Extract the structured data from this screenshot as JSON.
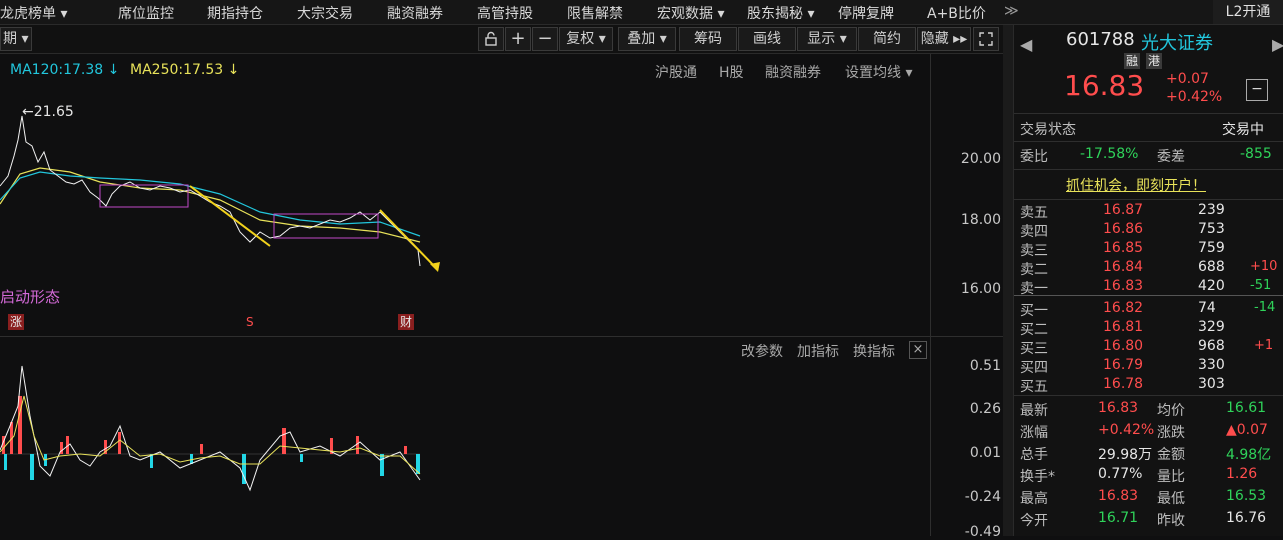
{
  "topnav": {
    "items": [
      "龙虎榜单 ▾",
      "席位监控",
      "期指持仓",
      "大宗交易",
      "融资融券",
      "高管持股",
      "限售解禁",
      "宏观数据 ▾",
      "股东揭秘 ▾",
      "停牌复牌",
      "A+B比价"
    ],
    "more": "≫",
    "l2": "L2开通"
  },
  "toolbar": {
    "period": "期 ▾",
    "buttons": [
      "复权 ▾",
      "叠加 ▾",
      "筹码",
      "画线",
      "显示 ▾",
      "简约",
      "隐藏 ▸▸"
    ],
    "plus": "+",
    "minus": "−"
  },
  "kchart": {
    "ma120": "MA120:17.38 ↓",
    "ma250": "MA250:17.53 ↓",
    "links": [
      "沪股通",
      "H股",
      "融资融券",
      "设置均线 ▾"
    ],
    "peak_label": "←21.65",
    "pattern_label": "启动形态",
    "markers": [
      "涨",
      "S",
      "财"
    ],
    "y_ticks": [
      "20.00",
      "18.00",
      "16.00"
    ]
  },
  "indicator": {
    "links": [
      "改参数",
      "加指标",
      "换指标"
    ],
    "close": "×",
    "y_ticks": [
      "0.51",
      "0.26",
      "0.01",
      "-0.24",
      "-0.49"
    ]
  },
  "stock": {
    "code": "601788",
    "name": "光大证券",
    "tags": [
      "融",
      "港"
    ],
    "price": "16.83",
    "change": "+0.07",
    "change_pct": "+0.42%",
    "status_label": "交易状态",
    "status_value": "交易中",
    "weibi_label": "委比",
    "weibi_value": "-17.58%",
    "weicha_label": "委差",
    "weicha_value": "-855",
    "promo": "抓住机会，即刻开户！"
  },
  "orderbook": {
    "sell": [
      {
        "label": "卖五",
        "price": "16.87",
        "vol": "239",
        "delta": ""
      },
      {
        "label": "卖四",
        "price": "16.86",
        "vol": "753",
        "delta": ""
      },
      {
        "label": "卖三",
        "price": "16.85",
        "vol": "759",
        "delta": ""
      },
      {
        "label": "卖二",
        "price": "16.84",
        "vol": "688",
        "delta": "+10"
      },
      {
        "label": "卖一",
        "price": "16.83",
        "vol": "420",
        "delta": "-51"
      }
    ],
    "buy": [
      {
        "label": "买一",
        "price": "16.82",
        "vol": "74",
        "delta": "-14"
      },
      {
        "label": "买二",
        "price": "16.81",
        "vol": "329",
        "delta": ""
      },
      {
        "label": "买三",
        "price": "16.80",
        "vol": "968",
        "delta": "+1"
      },
      {
        "label": "买四",
        "price": "16.79",
        "vol": "330",
        "delta": ""
      },
      {
        "label": "买五",
        "price": "16.78",
        "vol": "303",
        "delta": ""
      }
    ]
  },
  "stats": [
    {
      "l1": "最新",
      "v1": "16.83",
      "l2": "均价",
      "v2": "16.61"
    },
    {
      "l1": "涨幅",
      "v1": "+0.42%",
      "l2": "涨跌",
      "v2": "▲0.07"
    },
    {
      "l1": "总手",
      "v1": "29.98万",
      "l2": "金额",
      "v2": "4.98亿"
    },
    {
      "l1": "换手*",
      "v1": "0.77%",
      "l2": "量比",
      "v2": "1.26"
    },
    {
      "l1": "最高",
      "v1": "16.83",
      "l2": "最低",
      "v2": "16.53"
    },
    {
      "l1": "今开",
      "v1": "16.71",
      "l2": "昨收",
      "v2": "16.76"
    }
  ],
  "colors": {
    "up": "#ff4d4d",
    "down": "#2fd35a",
    "ma120": "#22c6dc",
    "ma250": "#e8e25a"
  }
}
